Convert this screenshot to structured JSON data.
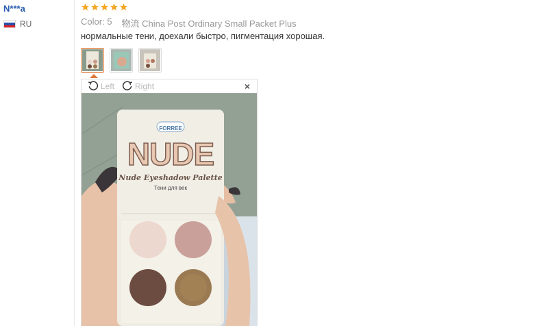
{
  "reviewer": {
    "name": "N***a",
    "country_code": "RU"
  },
  "review": {
    "rating": 5,
    "color_label": "Color:",
    "color_value": "5",
    "shipping": "物流 China Post Ordinary Small Packet Plus",
    "text": "нормальные тени, доехали быстро, пигментация хорошая."
  },
  "viewer": {
    "rotate_left": "Left",
    "rotate_right": "Right",
    "close": "×"
  },
  "product_photo": {
    "brand": "FORREE",
    "title": "NUDE",
    "subtitle": "Nude Eyeshadow Palette",
    "caption": "Тени для век"
  },
  "colors": {
    "star": "#f5a623",
    "accent": "#e07b39",
    "link": "#2a5db0"
  }
}
